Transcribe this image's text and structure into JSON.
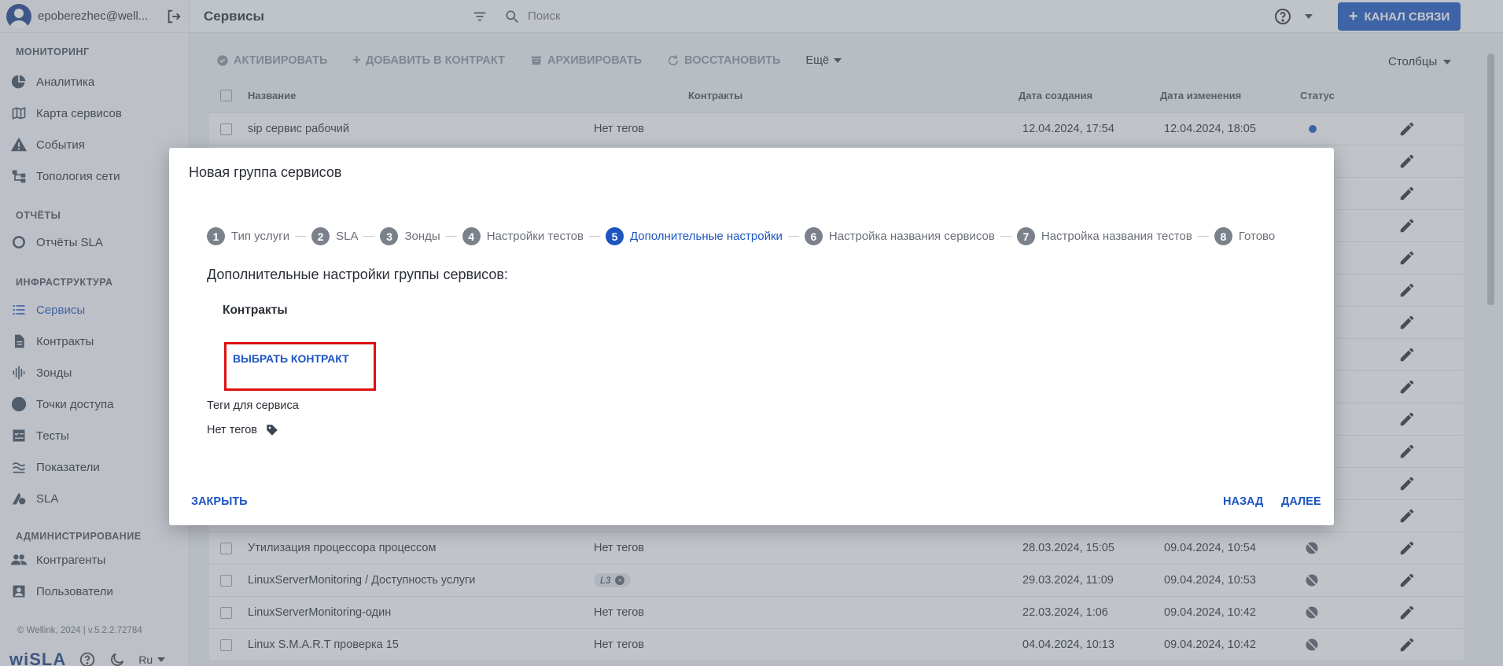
{
  "user": {
    "name": "epoberezhec@well..."
  },
  "sidebar": {
    "sections": [
      {
        "title": "МОНИТОРИНГ",
        "items": [
          {
            "label": "Аналитика",
            "icon": "pie-chart-icon"
          },
          {
            "label": "Карта сервисов",
            "icon": "map-icon"
          },
          {
            "label": "События",
            "icon": "warning-icon"
          },
          {
            "label": "Топология сети",
            "icon": "topology-icon"
          }
        ]
      },
      {
        "title": "ОТЧЁТЫ",
        "items": [
          {
            "label": "Отчёты SLA",
            "icon": "donut-icon"
          }
        ]
      },
      {
        "title": "ИНФРАСТРУКТУРА",
        "items": [
          {
            "label": "Сервисы",
            "icon": "list-icon"
          },
          {
            "label": "Контракты",
            "icon": "document-icon"
          },
          {
            "label": "Зонды",
            "icon": "waveform-icon"
          },
          {
            "label": "Точки доступа",
            "icon": "circle-icon"
          },
          {
            "label": "Тесты",
            "icon": "checklist-icon"
          },
          {
            "label": "Показатели",
            "icon": "metrics-icon"
          },
          {
            "label": "SLA",
            "icon": "sla-icon"
          }
        ]
      },
      {
        "title": "АДМИНИСТРИРОВАНИЕ",
        "items": [
          {
            "label": "Контрагенты",
            "icon": "group-icon"
          },
          {
            "label": "Пользователи",
            "icon": "user-card-icon"
          }
        ]
      }
    ],
    "copyright": "© Wellink, 2024 | v.5.2.2.72784",
    "logo": "wiSLA",
    "language": "Ru"
  },
  "topbar": {
    "title": "Сервисы",
    "search_placeholder": "Поиск",
    "channel_button": "КАНАЛ СВЯЗИ"
  },
  "toolbar": {
    "activate": "АКТИВИРОВАТЬ",
    "add_to_contract": "ДОБАВИТЬ В КОНТРАКТ",
    "archive": "АРХИВИРОВАТЬ",
    "restore": "ВОССТАНОВИТЬ",
    "more": "Ещё",
    "columns": "Столбцы"
  },
  "table": {
    "headers": {
      "name": "Название",
      "contracts": "Контракты",
      "created": "Дата создания",
      "modified": "Дата изменения",
      "status": "Статус"
    },
    "rows": [
      {
        "name": "sip сервис рабочий",
        "tags": "Нет тегов",
        "created": "12.04.2024, 17:54",
        "modified": "12.04.2024, 18:05",
        "status": "active"
      },
      {
        "name": "",
        "tags": "",
        "created": "",
        "modified": "",
        "status": ""
      },
      {
        "name": "",
        "tags": "",
        "created": "",
        "modified": "",
        "status": ""
      },
      {
        "name": "",
        "tags": "",
        "created": "",
        "modified": "",
        "status": ""
      },
      {
        "name": "",
        "tags": "",
        "created": "",
        "modified": "",
        "status": ""
      },
      {
        "name": "",
        "tags": "",
        "created": "",
        "modified": "",
        "status": ""
      },
      {
        "name": "",
        "tags": "",
        "created": "",
        "modified": "",
        "status": ""
      },
      {
        "name": "",
        "tags": "",
        "created": "",
        "modified": "",
        "status": ""
      },
      {
        "name": "",
        "tags": "",
        "created": "",
        "modified": "",
        "status": ""
      },
      {
        "name": "",
        "tags": "",
        "created": "",
        "modified": "",
        "status": ""
      },
      {
        "name": "",
        "tags": "",
        "created": "",
        "modified": "",
        "status": ""
      },
      {
        "name": "",
        "tags": "",
        "created": "",
        "modified": "",
        "status": ""
      },
      {
        "name": "",
        "tags": "",
        "created": "",
        "modified": "",
        "status": ""
      },
      {
        "name": "Утилизация процессора процессом",
        "tags": "Нет тегов",
        "created": "28.03.2024, 15:05",
        "modified": "09.04.2024, 10:54",
        "status": "off"
      },
      {
        "name": "LinuxServerMonitoring / Доступность услуги",
        "tags": "L3",
        "created": "29.03.2024, 11:09",
        "modified": "09.04.2024, 10:53",
        "status": "off"
      },
      {
        "name": "LinuxServerMonitoring-один",
        "tags": "Нет тегов",
        "created": "22.03.2024, 1:06",
        "modified": "09.04.2024, 10:42",
        "status": "off"
      },
      {
        "name": "Linux S.M.A.R.T проверка 15",
        "tags": "Нет тегов",
        "created": "04.04.2024, 10:13",
        "modified": "09.04.2024, 10:42",
        "status": "off"
      }
    ]
  },
  "modal": {
    "title": "Новая группа сервисов",
    "steps": [
      {
        "num": "1",
        "label": "Тип услуги"
      },
      {
        "num": "2",
        "label": "SLA"
      },
      {
        "num": "3",
        "label": "Зонды"
      },
      {
        "num": "4",
        "label": "Настройки тестов"
      },
      {
        "num": "5",
        "label": "Дополнительные настройки"
      },
      {
        "num": "6",
        "label": "Настройка названия сервисов"
      },
      {
        "num": "7",
        "label": "Настройка названия тестов"
      },
      {
        "num": "8",
        "label": "Готово"
      }
    ],
    "active_step": 5,
    "section_heading": "Дополнительные настройки группы сервисов:",
    "contracts_label": "Контракты",
    "select_contract": "ВЫБРАТЬ КОНТРАКТ",
    "tags_label": "Теги для сервиса",
    "no_tags": "Нет тегов",
    "close": "ЗАКРЫТЬ",
    "back": "НАЗАД",
    "next": "ДАЛЕЕ"
  },
  "colors": {
    "accent": "#1c55c0",
    "highlight": "#e01010"
  }
}
